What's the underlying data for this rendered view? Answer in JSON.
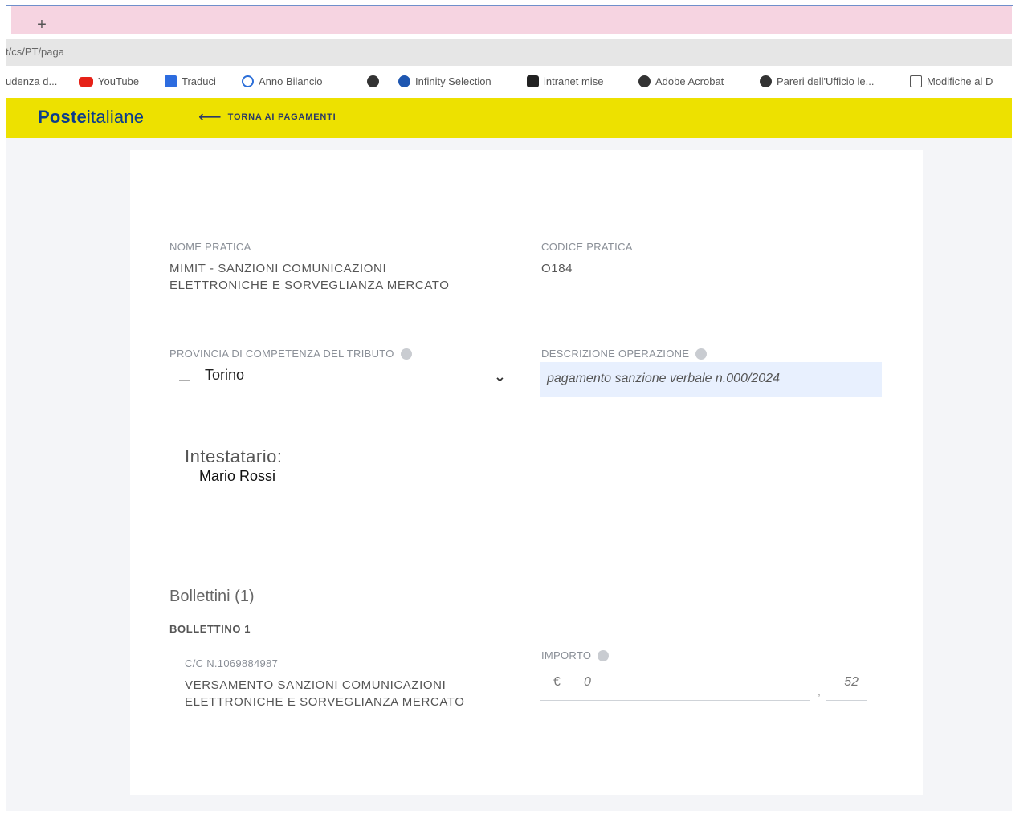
{
  "browser": {
    "new_tab": "+",
    "url": "t/cs/PT/paga",
    "bookmarks": [
      {
        "label": "udenza d...",
        "icon": "none"
      },
      {
        "label": "YouTube",
        "icon": "youtube-icon"
      },
      {
        "label": "Traduci",
        "icon": "translate-icon"
      },
      {
        "label": "Anno Bilancio",
        "icon": "link-icon"
      },
      {
        "label": "",
        "icon": "globe-icon"
      },
      {
        "label": "Infinity Selection",
        "icon": "infinity-icon"
      },
      {
        "label": "intranet mise",
        "icon": "intranet-icon"
      },
      {
        "label": "Adobe Acrobat",
        "icon": "globe-icon"
      },
      {
        "label": "Pareri dell'Ufficio le...",
        "icon": "globe-icon"
      },
      {
        "label": "Modifiche al D",
        "icon": "document-icon"
      }
    ]
  },
  "header": {
    "logo_bold": "Poste",
    "logo_light": "italiane",
    "back_arrow": "⟵",
    "back_label": "TORNA AI PAGAMENTI",
    "brand_color": "#ede100"
  },
  "form": {
    "nome_pratica_label": "NOME PRATICA",
    "nome_pratica_value": "MIMIT - SANZIONI COMUNICAZIONI ELETTRONICHE E SORVEGLIANZA MERCATO",
    "codice_pratica_label": "CODICE PRATICA",
    "codice_pratica_value": "O184",
    "provincia_label": "PROVINCIA DI COMPETENZA DEL TRIBUTO",
    "provincia_dash": "—",
    "provincia_value": "Torino",
    "chevron": "⌄",
    "descrizione_label": "DESCRIZIONE OPERAZIONE",
    "descrizione_value": "pagamento sanzione verbale n.000/2024"
  },
  "intestatario": {
    "title": "Intestatario:",
    "name": "Mario Rossi"
  },
  "bollettini": {
    "title": "Bollettini (1)",
    "item_label": "BOLLETTINO 1",
    "conto": "C/C N.1069884987",
    "causale": "VERSAMENTO SANZIONI COMUNICAZIONI ELETTRONICHE E SORVEGLIANZA MERCATO",
    "importo_label": "IMPORTO",
    "currency": "€",
    "amount_integer": "0",
    "amount_separator": ",",
    "amount_decimal": "52"
  }
}
